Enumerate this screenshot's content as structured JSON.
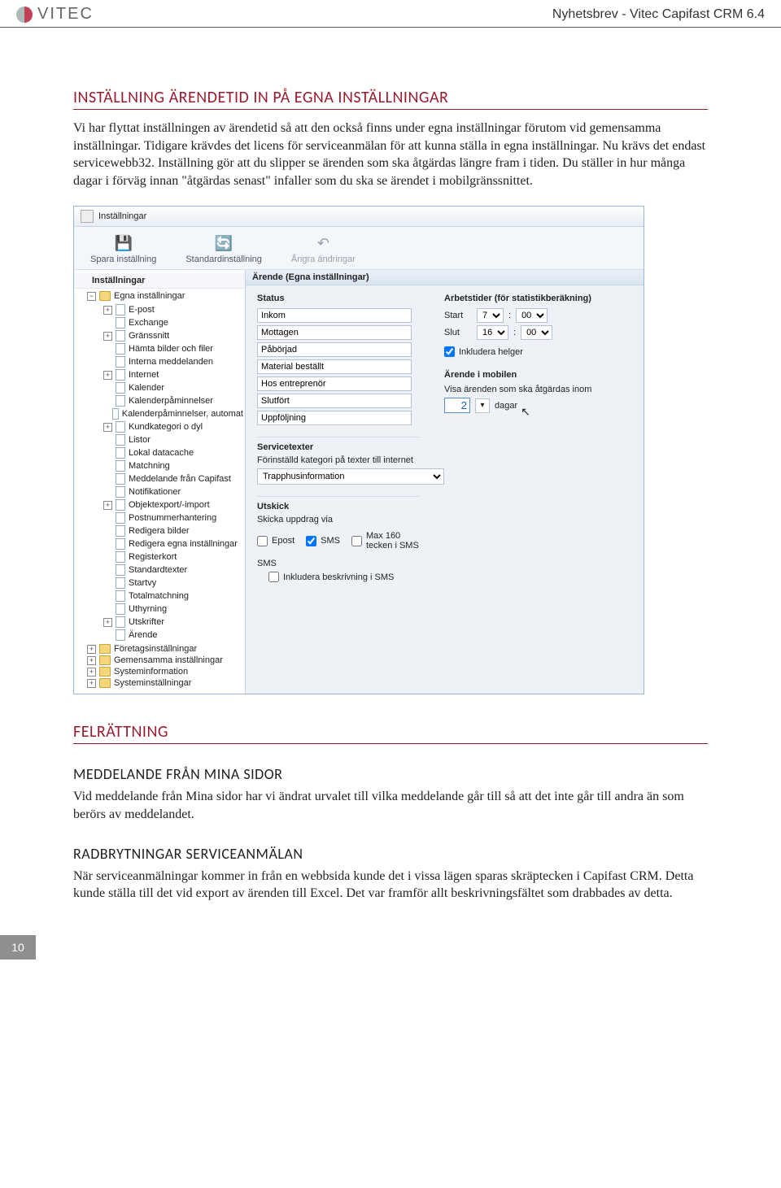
{
  "header": {
    "logo_text": "VITEC",
    "doc_title": "Nyhetsbrev - Vitec Capifast CRM 6.4"
  },
  "section1": {
    "title": "INSTÄLLNING ÄRENDETID IN PÅ EGNA INSTÄLLNINGAR",
    "body": "Vi har flyttat inställningen av ärendetid så att den också finns under egna inställningar förutom vid gemensamma inställningar. Tidigare krävdes det licens för serviceanmälan för att kunna ställa in egna inställningar. Nu krävs det endast servicewebb32. Inställning gör att du slipper se ärenden som ska åtgärdas längre fram i tiden. Du ställer in hur många dagar i förväg innan \"åtgärdas senast\" infaller som du ska se ärendet i mobilgränssnittet."
  },
  "app": {
    "window_title": "Inställningar",
    "toolbar": {
      "save": "Spara inställning",
      "reset": "Standardinställning",
      "undo": "Ångra ändringar"
    },
    "tree_root": "Inställningar",
    "tree": {
      "top": "Egna inställningar",
      "items": [
        "E-post",
        "Exchange",
        "Gränssnitt",
        "Hämta bilder och filer",
        "Interna meddelanden",
        "Internet",
        "Kalender",
        "Kalenderpåminnelser",
        "Kalenderpåminnelser, automat",
        "Kundkategori o dyl",
        "Listor",
        "Lokal datacache",
        "Matchning",
        "Meddelande från Capifast",
        "Notifikationer",
        "Objektexport/-import",
        "Postnummerhantering",
        "Redigera bilder",
        "Redigera egna inställningar",
        "Registerkort",
        "Standardtexter",
        "Startvy",
        "Totalmatchning",
        "Uthyrning",
        "Utskrifter",
        "Ärende"
      ],
      "bottom": [
        "Företagsinställningar",
        "Gemensamma inställningar",
        "Systeminformation",
        "Systeminställningar"
      ]
    },
    "form": {
      "header": "Ärende (Egna inställningar)",
      "status_title": "Status",
      "status": [
        "Inkom",
        "Mottagen",
        "Påbörjad",
        "Material beställt",
        "Hos entreprenör",
        "Slutfört",
        "Uppföljning"
      ],
      "arbets_title": "Arbetstider (för statistikberäkning)",
      "start_label": "Start",
      "start_h": "7",
      "start_m": "00",
      "slut_label": "Slut",
      "slut_h": "16",
      "slut_m": "00",
      "helg_label": "Inkludera helger",
      "mobile_title": "Ärende i mobilen",
      "mobile_desc": "Visa ärenden som ska åtgärdas inom",
      "mobile_value": "2",
      "mobile_unit": "dagar",
      "svc_title": "Servicetexter",
      "svc_desc": "Förinställd kategori på texter till internet",
      "svc_value": "Trapphusinformation",
      "uts_title": "Utskick",
      "uts_desc": "Skicka uppdrag via",
      "uts_epost": "Epost",
      "uts_sms": "SMS",
      "uts_max": "Max 160 tecken i SMS",
      "sms_label": "SMS",
      "sms_inc": "Inkludera beskrivning i SMS"
    }
  },
  "section2": {
    "title": "FELRÄTTNING",
    "sub1_title": "MEDDELANDE FRÅN MINA SIDOR",
    "sub1_body": "Vid meddelande från Mina sidor har vi ändrat urvalet till vilka meddelande går till så att det inte går till andra än som berörs av meddelandet.",
    "sub2_title": "RADBRYTNINGAR SERVICEANMÄLAN",
    "sub2_body": "När serviceanmälningar kommer in från en webbsida kunde det i vissa lägen sparas skräptecken i Capifast CRM. Detta kunde ställa till det vid export av ärenden till Excel. Det var framför allt beskrivningsfältet som drabbades av detta."
  },
  "page_number": "10"
}
